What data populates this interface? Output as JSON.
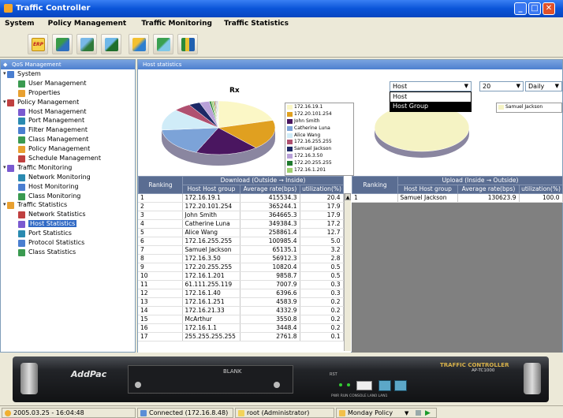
{
  "window": {
    "title": "Traffic Controller",
    "min": "_",
    "max": "□",
    "close": "✕"
  },
  "menu": [
    "System",
    "Policy Management",
    "Traffic Monitoring",
    "Traffic Statistics"
  ],
  "toolbar": {
    "erp_label": "ERP"
  },
  "left_panel": {
    "title": "QoS Management",
    "tree": [
      {
        "label": "System",
        "level": 0,
        "icon": "system-icon"
      },
      {
        "label": "User Management",
        "level": 1,
        "icon": "users-icon"
      },
      {
        "label": "Properties",
        "level": 1,
        "icon": "properties-icon"
      },
      {
        "label": "Policy Management",
        "level": 0,
        "icon": "policy-icon"
      },
      {
        "label": "Host Management",
        "level": 1,
        "icon": "host-icon"
      },
      {
        "label": "Port Management",
        "level": 1,
        "icon": "port-icon"
      },
      {
        "label": "Filter Management",
        "level": 1,
        "icon": "filter-icon"
      },
      {
        "label": "Class Management",
        "level": 1,
        "icon": "class-icon"
      },
      {
        "label": "Policy Management",
        "level": 1,
        "icon": "policy-doc-icon"
      },
      {
        "label": "Schedule Management",
        "level": 1,
        "icon": "schedule-icon"
      },
      {
        "label": "Traffic Monitoring",
        "level": 0,
        "icon": "monitor-icon"
      },
      {
        "label": "Network Monitoring",
        "level": 1,
        "icon": "network-icon"
      },
      {
        "label": "Host Monitoring",
        "level": 1,
        "icon": "host-monitor-icon"
      },
      {
        "label": "Class Monitoring",
        "level": 1,
        "icon": "class-monitor-icon"
      },
      {
        "label": "Traffic Statistics",
        "level": 0,
        "icon": "statistics-icon"
      },
      {
        "label": "Network Statistics",
        "level": 1,
        "icon": "network-stat-icon"
      },
      {
        "label": "Host Statistics",
        "level": 1,
        "icon": "host-stat-icon",
        "selected": true
      },
      {
        "label": "Port Statistics",
        "level": 1,
        "icon": "port-stat-icon"
      },
      {
        "label": "Protocol Statistics",
        "level": 1,
        "icon": "protocol-stat-icon"
      },
      {
        "label": "Class Statistics",
        "level": 1,
        "icon": "class-stat-icon"
      }
    ]
  },
  "right_panel": {
    "title": "Host statistics",
    "rx_label": "Rx",
    "host_select": {
      "value": "Host",
      "options": [
        "Host",
        "Host Group"
      ],
      "highlighted": "Host Group"
    },
    "count_select": {
      "value": "20"
    },
    "period_select": {
      "value": "Daily"
    },
    "rx_legend": [
      {
        "label": "172.16.19.1",
        "color": "#fbf7c6"
      },
      {
        "label": "172.20.101.254",
        "color": "#e0a020"
      },
      {
        "label": "John Smith",
        "color": "#4a1660"
      },
      {
        "label": "Catherine Luna",
        "color": "#7ca3d8"
      },
      {
        "label": "Alice Wang",
        "color": "#d0ecf8"
      },
      {
        "label": "172.16.255.255",
        "color": "#b05070"
      },
      {
        "label": "Samuel Jackson",
        "color": "#1c2866"
      },
      {
        "label": "172.16.3.50",
        "color": "#b8a0d8"
      },
      {
        "label": "172.20.255.255",
        "color": "#1f7a2e"
      },
      {
        "label": "172.16.1.201",
        "color": "#9ed070"
      }
    ],
    "tx_legend": [
      {
        "label": "Samuel Jackson",
        "color": "#f5f3c4"
      }
    ],
    "download": {
      "ranking_header": "Ranking",
      "title": "Download (Outside → Inside)",
      "col_host": "Host Host group",
      "col_rate": "Average rate(bps)",
      "col_util": "utilization(%)",
      "rows": [
        [
          "1",
          "172.16.19.1",
          "415534.3",
          "20.4"
        ],
        [
          "2",
          "172.20.101.254",
          "365244.1",
          "17.9"
        ],
        [
          "3",
          "John Smith",
          "364665.3",
          "17.9"
        ],
        [
          "4",
          "Catherine Luna",
          "349384.3",
          "17.2"
        ],
        [
          "5",
          "Alice Wang",
          "258861.4",
          "12.7"
        ],
        [
          "6",
          "172.16.255.255",
          "100985.4",
          "5.0"
        ],
        [
          "7",
          "Samuel Jackson",
          "65135.1",
          "3.2"
        ],
        [
          "8",
          "172.16.3.50",
          "56912.3",
          "2.8"
        ],
        [
          "9",
          "172.20.255.255",
          "10820.4",
          "0.5"
        ],
        [
          "10",
          "172.16.1.201",
          "9858.7",
          "0.5"
        ],
        [
          "11",
          "61.111.255.119",
          "7007.9",
          "0.3"
        ],
        [
          "12",
          "172.16.1.40",
          "6396.6",
          "0.3"
        ],
        [
          "13",
          "172.16.1.251",
          "4583.9",
          "0.2"
        ],
        [
          "14",
          "172.16.21.33",
          "4332.9",
          "0.2"
        ],
        [
          "15",
          "McArthur",
          "3550.8",
          "0.2"
        ],
        [
          "16",
          "172.16.1.1",
          "3448.4",
          "0.2"
        ],
        [
          "17",
          "255.255.255.255",
          "2761.8",
          "0.1"
        ]
      ]
    },
    "upload": {
      "ranking_header": "Ranking",
      "title": "Upload (Inside → Outside)",
      "col_host": "Host Host group",
      "col_rate": "Average rate(bps)",
      "col_util": "utilization(%)",
      "rows": [
        [
          "1",
          "Samuel Jackson",
          "130623.9",
          "100.0"
        ]
      ]
    }
  },
  "device": {
    "brand": "AddPac",
    "blank": "BLANK",
    "rst": "RST",
    "leds": "PWR RUN CONSOLE LAN0 LAN1",
    "model_name": "TRAFFIC CONTROLLER",
    "model_no": "AP-TC1000"
  },
  "status": {
    "datetime": "2005.03.25 - 16:04:48",
    "connection": "Connected (172.16.8.48)",
    "user": "root (Administrator)",
    "policy": "Monday Policy"
  }
}
